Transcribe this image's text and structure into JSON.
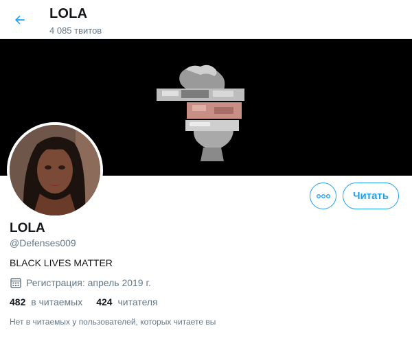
{
  "header": {
    "title": "LOLA",
    "tweet_count": "4 085 твитов"
  },
  "profile": {
    "name": "LOLA",
    "handle": "@Defenses009",
    "bio": "BLACK LIVES MATTER",
    "joined": "Регистрация: апрель 2019 г.",
    "following_count": "482",
    "following_label": "в читаемых",
    "followers_count": "424",
    "followers_label": "читателя",
    "note": "Нет в читаемых у пользователей, которых читаете вы"
  },
  "actions": {
    "follow_label": "Читать"
  },
  "icons": {
    "back": "arrow-left-icon",
    "more": "more-icon",
    "calendar": "calendar-icon"
  },
  "colors": {
    "accent": "#1da1f2",
    "banner": "#000000",
    "text": "#14171a",
    "muted": "#657786"
  }
}
